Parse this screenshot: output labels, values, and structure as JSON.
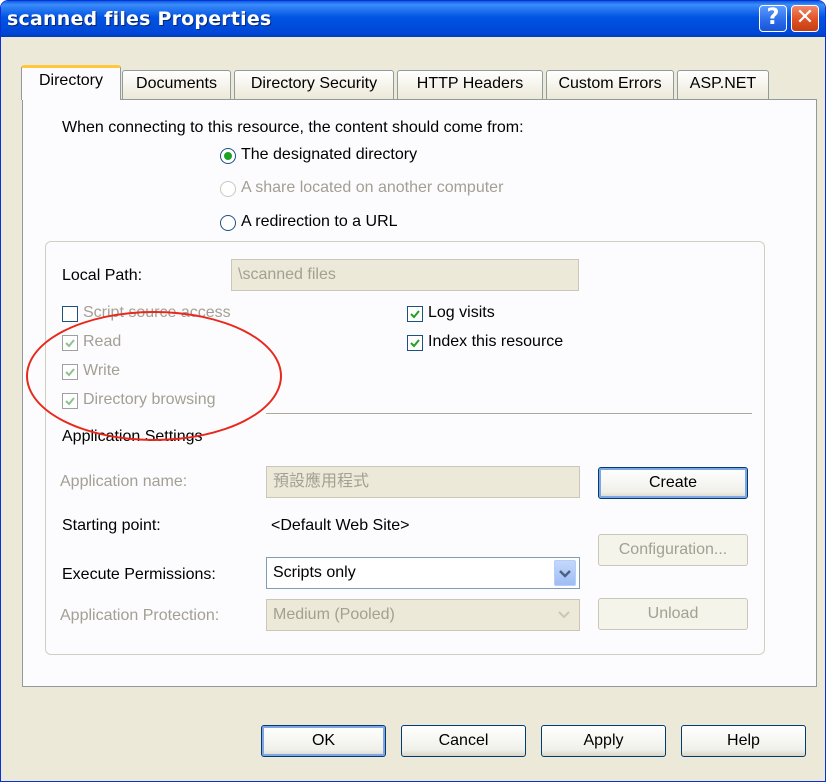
{
  "window": {
    "title": "scanned files Properties"
  },
  "tabs": [
    {
      "label": "Directory"
    },
    {
      "label": "Documents"
    },
    {
      "label": "Directory Security"
    },
    {
      "label": "HTTP Headers"
    },
    {
      "label": "Custom Errors"
    },
    {
      "label": "ASP.NET"
    }
  ],
  "content_source": {
    "prompt": "When connecting to this resource, the content should come from:",
    "options": [
      {
        "label": "The designated directory",
        "selected": true,
        "enabled": true
      },
      {
        "label": "A share located on another computer",
        "selected": false,
        "enabled": false
      },
      {
        "label": "A redirection to a URL",
        "selected": false,
        "enabled": true
      }
    ]
  },
  "local_path": {
    "label": "Local Path:",
    "value": "\\scanned files"
  },
  "permissions": [
    {
      "label": "Script source access",
      "checked": false
    },
    {
      "label": "Read",
      "checked": true
    },
    {
      "label": "Write",
      "checked": true
    },
    {
      "label": "Directory browsing",
      "checked": true
    },
    {
      "label": "Log visits",
      "checked": true
    },
    {
      "label": "Index this resource",
      "checked": true
    }
  ],
  "app_settings": {
    "heading": "Application Settings",
    "app_name_label": "Application name:",
    "app_name_value": "預設應用程式",
    "starting_point_label": "Starting point:",
    "starting_point_value": "<Default Web Site>",
    "execute_label": "Execute Permissions:",
    "execute_value": "Scripts only",
    "protection_label": "Application Protection:",
    "protection_value": "Medium (Pooled)",
    "create_button": "Create",
    "configuration_button": "Configuration...",
    "unload_button": "Unload"
  },
  "footer": {
    "ok": "OK",
    "cancel": "Cancel",
    "apply": "Apply",
    "help": "Help"
  },
  "title_buttons": {
    "help": "?",
    "close": "✕"
  },
  "colors": {
    "titlebar": "#0054e3",
    "tab_highlight": "#ffc83c",
    "annotation_circle": "#e8281a",
    "check": "#21a121"
  }
}
